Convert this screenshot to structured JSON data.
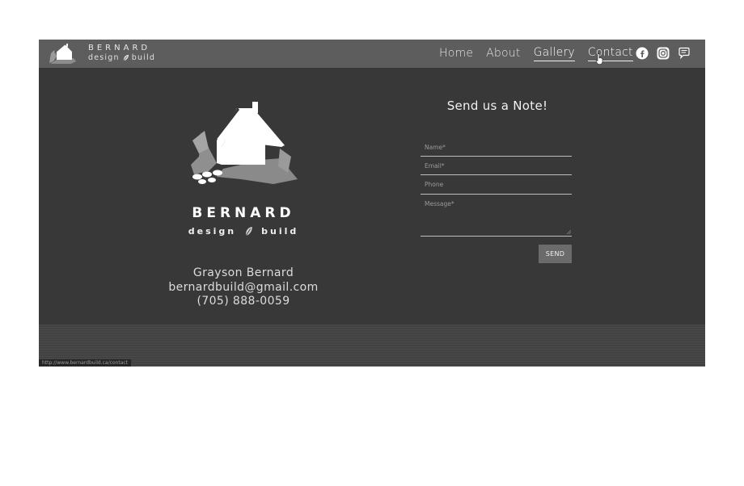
{
  "brand": {
    "name": "BERNARD",
    "sub_left": "design",
    "sub_right": "build"
  },
  "nav": {
    "items": [
      {
        "label": "Home"
      },
      {
        "label": "About"
      },
      {
        "label": "Gallery"
      },
      {
        "label": "Contact"
      }
    ]
  },
  "socials": [
    "facebook-icon",
    "instagram-icon",
    "chat-icon"
  ],
  "contact": {
    "name": "Grayson Bernard",
    "email": "bernardbuild@gmail.com",
    "phone": "(705) 888-0059"
  },
  "form": {
    "title": "Send us a Note!",
    "name_placeholder": "Name*",
    "email_placeholder": "Email*",
    "phone_placeholder": "Phone",
    "message_placeholder": "Message*",
    "send_label": "SEND"
  },
  "status_bar": {
    "url": "http://www.bernardbuild.ca/contact"
  },
  "colors": {
    "navbar": "#5d5d5d",
    "background": "#383838",
    "button": "#6b6b6b"
  }
}
